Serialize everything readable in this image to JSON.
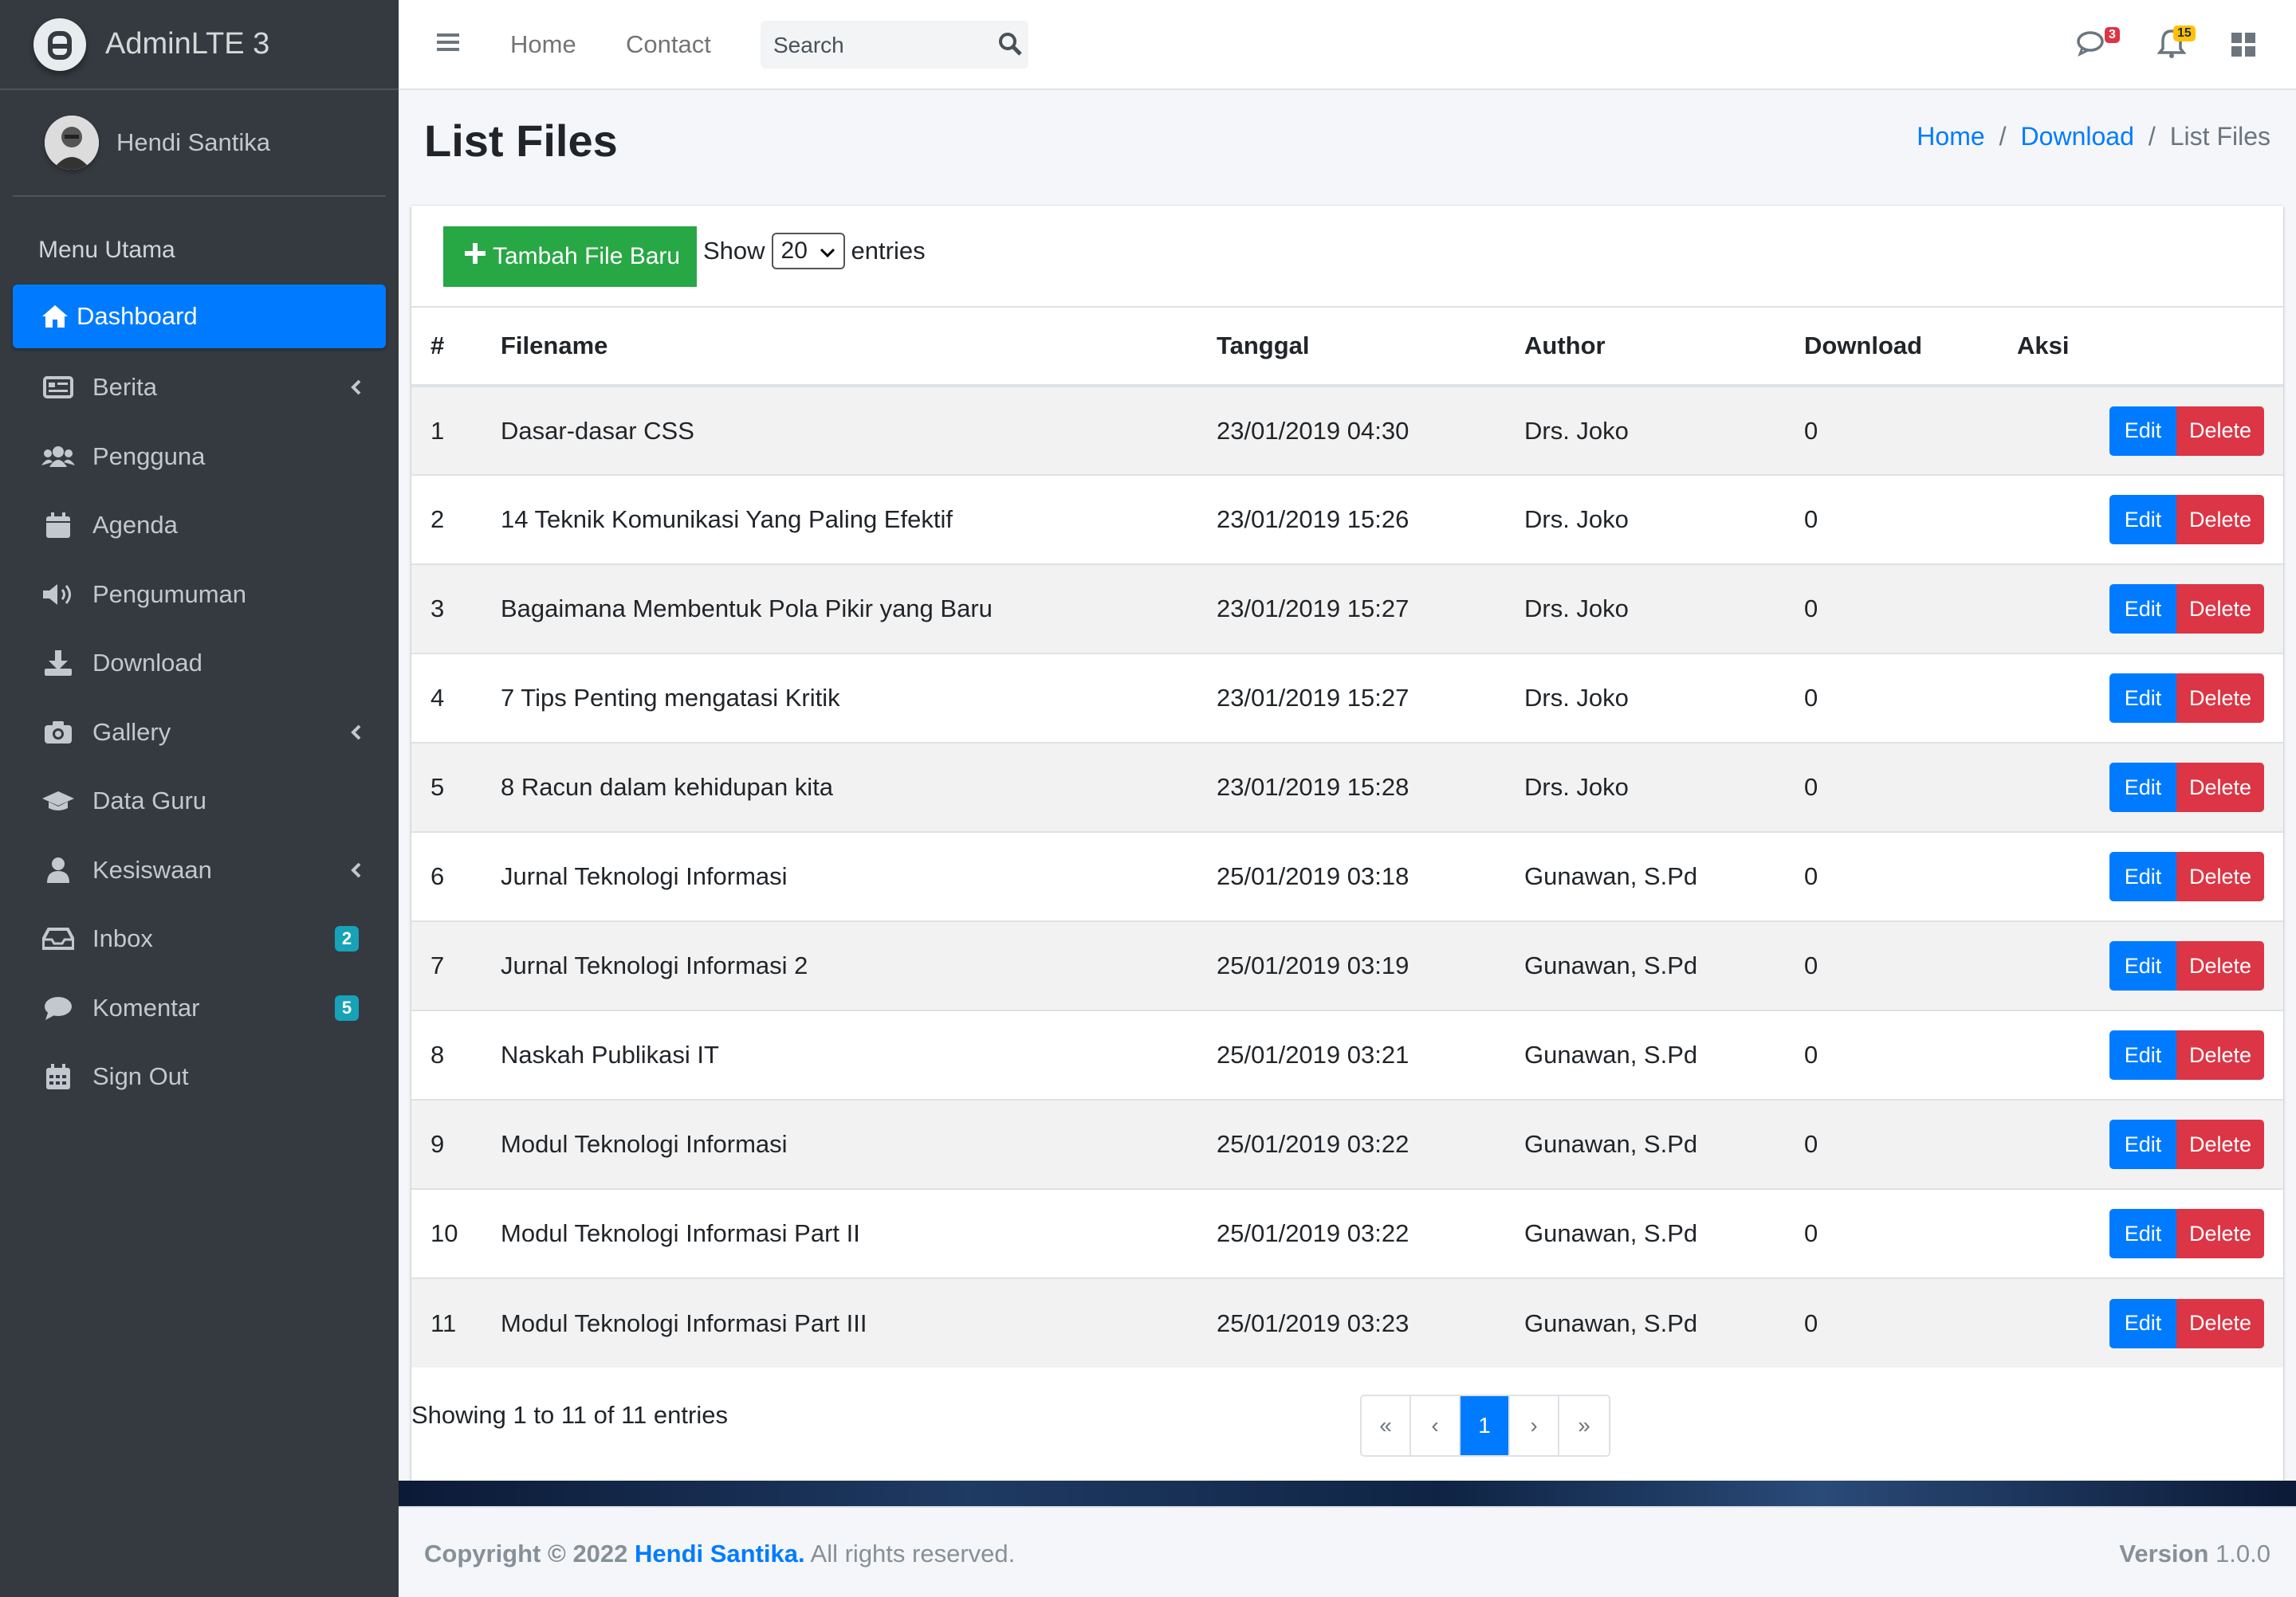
{
  "brand": {
    "name": "AdminLTE 3"
  },
  "user": {
    "name": "Hendi Santika"
  },
  "sidebar": {
    "header": "Menu Utama",
    "items": [
      {
        "label": "Dashboard",
        "icon": "home-icon",
        "active": true
      },
      {
        "label": "Berita",
        "icon": "newspaper-icon",
        "arrow": true
      },
      {
        "label": "Pengguna",
        "icon": "users-icon"
      },
      {
        "label": "Agenda",
        "icon": "calendar-icon"
      },
      {
        "label": "Pengumuman",
        "icon": "megaphone-icon"
      },
      {
        "label": "Download",
        "icon": "download-icon"
      },
      {
        "label": "Gallery",
        "icon": "camera-icon",
        "arrow": true
      },
      {
        "label": "Data Guru",
        "icon": "graduation-cap-icon"
      },
      {
        "label": "Kesiswaan",
        "icon": "user-icon",
        "arrow": true
      },
      {
        "label": "Inbox",
        "icon": "inbox-icon",
        "badge": "2"
      },
      {
        "label": "Komentar",
        "icon": "comment-icon",
        "badge": "5"
      },
      {
        "label": "Sign Out",
        "icon": "calendar-grid-icon"
      }
    ]
  },
  "topbar": {
    "links": [
      "Home",
      "Contact"
    ],
    "search_placeholder": "Search",
    "messages_count": "3",
    "notifications_count": "15"
  },
  "page": {
    "title": "List Files"
  },
  "breadcrumb": {
    "home": "Home",
    "download": "Download",
    "current": "List Files"
  },
  "toolbar": {
    "add_label": "Tambah File Baru",
    "show_label": "Show",
    "entries_value": "20",
    "entries_label": "entries"
  },
  "table": {
    "headers": [
      "#",
      "Filename",
      "Tanggal",
      "Author",
      "Download",
      "Aksi"
    ],
    "edit_label": "Edit",
    "delete_label": "Delete",
    "rows": [
      {
        "no": "1",
        "filename": "Dasar-dasar CSS",
        "tanggal": "23/01/2019 04:30",
        "author": "Drs. Joko",
        "download": "0"
      },
      {
        "no": "2",
        "filename": "14 Teknik Komunikasi Yang Paling Efektif",
        "tanggal": "23/01/2019 15:26",
        "author": "Drs. Joko",
        "download": "0"
      },
      {
        "no": "3",
        "filename": "Bagaimana Membentuk Pola Pikir yang Baru",
        "tanggal": "23/01/2019 15:27",
        "author": "Drs. Joko",
        "download": "0"
      },
      {
        "no": "4",
        "filename": "7 Tips Penting mengatasi Kritik",
        "tanggal": "23/01/2019 15:27",
        "author": "Drs. Joko",
        "download": "0"
      },
      {
        "no": "5",
        "filename": "8 Racun dalam kehidupan kita",
        "tanggal": "23/01/2019 15:28",
        "author": "Drs. Joko",
        "download": "0"
      },
      {
        "no": "6",
        "filename": "Jurnal Teknologi Informasi",
        "tanggal": "25/01/2019 03:18",
        "author": "Gunawan, S.Pd",
        "download": "0"
      },
      {
        "no": "7",
        "filename": "Jurnal Teknologi Informasi 2",
        "tanggal": "25/01/2019 03:19",
        "author": "Gunawan, S.Pd",
        "download": "0"
      },
      {
        "no": "8",
        "filename": "Naskah Publikasi IT",
        "tanggal": "25/01/2019 03:21",
        "author": "Gunawan, S.Pd",
        "download": "0"
      },
      {
        "no": "9",
        "filename": "Modul Teknologi Informasi",
        "tanggal": "25/01/2019 03:22",
        "author": "Gunawan, S.Pd",
        "download": "0"
      },
      {
        "no": "10",
        "filename": "Modul Teknologi Informasi Part II",
        "tanggal": "25/01/2019 03:22",
        "author": "Gunawan, S.Pd",
        "download": "0"
      },
      {
        "no": "11",
        "filename": "Modul Teknologi Informasi Part III",
        "tanggal": "25/01/2019 03:23",
        "author": "Gunawan, S.Pd",
        "download": "0"
      }
    ]
  },
  "pagination": {
    "info": "Showing 1 to 11 of 11 entries",
    "first": "«",
    "prev": "‹",
    "current": "1",
    "next": "›",
    "last": "»"
  },
  "footer": {
    "copyright_prefix": "Copyright © 2022",
    "author": "Hendi Santika.",
    "suffix": "All rights reserved.",
    "version_label": "Version",
    "version": "1.0.0"
  },
  "colors": {
    "primary": "#007bff",
    "success": "#28a745",
    "danger": "#dc3545",
    "sidebar": "#343a40",
    "badge": "#17a2b8"
  }
}
